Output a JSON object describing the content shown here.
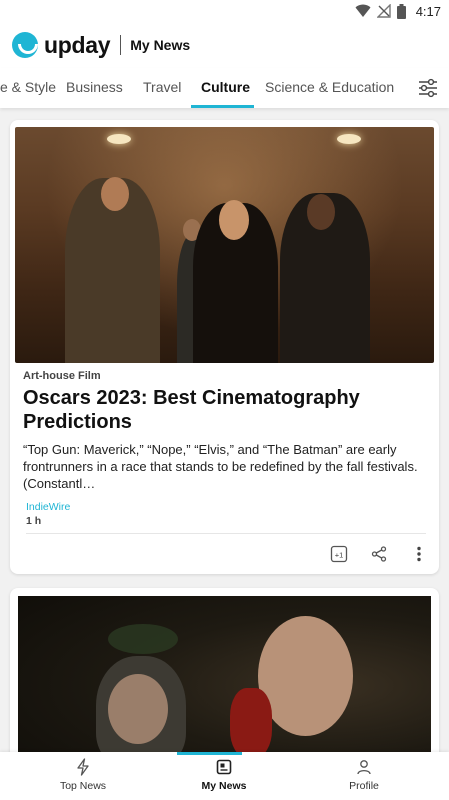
{
  "status_bar": {
    "time": "4:17",
    "icons": [
      "wifi-icon",
      "no-signal-icon",
      "battery-icon"
    ]
  },
  "header": {
    "brand": "upday",
    "section": "My News",
    "brand_color": "#1fb5d4"
  },
  "tabs": [
    {
      "label": "e & Style"
    },
    {
      "label": "Business"
    },
    {
      "label": "Travel"
    },
    {
      "label": "Culture",
      "active": true
    },
    {
      "label": "Science & Education"
    }
  ],
  "articles": [
    {
      "category": "Art-house Film",
      "title": "Oscars 2023: Best Cinematography Predictions",
      "excerpt": "“Top Gun: Maverick,” “Nope,” “Elvis,” and “The Batman” are early frontrunners in a race that stands to be redefined by the fall festivals. (Constantl…",
      "source": "IndieWire",
      "age": "1 h",
      "actions": [
        "plus-one-icon",
        "share-icon",
        "more-vertical-icon"
      ]
    },
    {
      "image": "film-still-phone-call"
    }
  ],
  "bottom_nav": [
    {
      "label": "Top News",
      "icon": "lightning-icon"
    },
    {
      "label": "My News",
      "icon": "my-news-icon",
      "active": true
    },
    {
      "label": "Profile",
      "icon": "person-icon"
    }
  ]
}
